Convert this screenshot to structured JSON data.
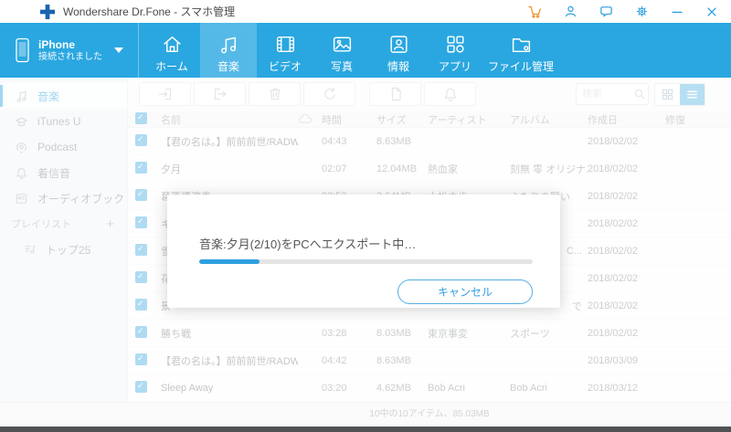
{
  "window": {
    "title": "Wondershare Dr.Fone - スマホ管理"
  },
  "navbar": {
    "device": {
      "name": "iPhone",
      "status": "接続されました"
    },
    "tabs": [
      {
        "label": "ホーム",
        "active": false
      },
      {
        "label": "音楽",
        "active": true
      },
      {
        "label": "ビデオ",
        "active": false
      },
      {
        "label": "写真",
        "active": false
      },
      {
        "label": "情報",
        "active": false
      },
      {
        "label": "アプリ",
        "active": false
      },
      {
        "label": "ファイル管理",
        "active": false
      }
    ]
  },
  "sidebar": {
    "items": [
      {
        "label": "音楽",
        "active": true
      },
      {
        "label": "iTunes U",
        "active": false
      },
      {
        "label": "Podcast",
        "active": false
      },
      {
        "label": "着信音",
        "active": false
      },
      {
        "label": "オーディオブック",
        "active": false
      }
    ],
    "playlist_header": "プレイリスト",
    "playlist_add": "+",
    "playlist_items": [
      {
        "label": "トップ25"
      }
    ]
  },
  "toolbar": {
    "search_placeholder": "検索"
  },
  "table": {
    "columns": {
      "name": "名前",
      "time": "時間",
      "size": "サイズ",
      "artist": "アーティスト",
      "album": "アルバム",
      "created": "作成日",
      "repair": "修復"
    },
    "rows": [
      {
        "name": "【君の名は。】前前前世/RADW...",
        "time": "04:43",
        "size": "8.63MB",
        "artist": "",
        "album": "",
        "date": "2018/02/02"
      },
      {
        "name": "夕月",
        "time": "02:07",
        "size": "12.04MB",
        "artist": "熱血家",
        "album": "刻無 零 オリジナ...",
        "date": "2018/02/02"
      },
      {
        "name": "葛原煙演奏",
        "time": "03:52",
        "size": "3.64MB",
        "artist": "小松未歩",
        "album": "ふたりの願い",
        "date": "2018/02/02"
      },
      {
        "name": "キ",
        "time": "",
        "size": "",
        "artist": "",
        "album": "",
        "date": "2018/02/02"
      },
      {
        "name": "雪",
        "time": "",
        "size": "",
        "artist": "",
        "album": "C...",
        "date": "2018/02/02",
        "frag": true
      },
      {
        "name": "花",
        "time": "",
        "size": "",
        "artist": "",
        "album": "",
        "date": "2018/02/02"
      },
      {
        "name": "景",
        "time": "",
        "size": "",
        "artist": "",
        "album": "で",
        "date": "2018/02/02",
        "frag": true
      },
      {
        "name": "勝ち戦",
        "time": "03:28",
        "size": "8.03MB",
        "artist": "東京事変",
        "album": "スポーツ",
        "date": "2018/02/02"
      },
      {
        "name": "【君の名は。】前前前世/RADW...",
        "time": "04:42",
        "size": "8.63MB",
        "artist": "",
        "album": "",
        "date": "2018/03/09"
      },
      {
        "name": "Sleep Away",
        "time": "03:20",
        "size": "4.62MB",
        "artist": "Bob Acri",
        "album": "Bob Acri",
        "date": "2018/03/12"
      }
    ]
  },
  "modal": {
    "message": "音楽:夕月(2/10)をPCへエクスポート中…",
    "progress_percent": 18,
    "cancel_label": "キャンセル"
  },
  "statusbar": {
    "text": "10中の10アイテム、85.03MB"
  },
  "colors": {
    "brand_blue": "#2aa7e0",
    "active_tab_blue": "#55b9e8",
    "accent_orange": "#f0922f",
    "progress_blue": "#2f9fe0",
    "logo_blue": "#1b63ad"
  }
}
